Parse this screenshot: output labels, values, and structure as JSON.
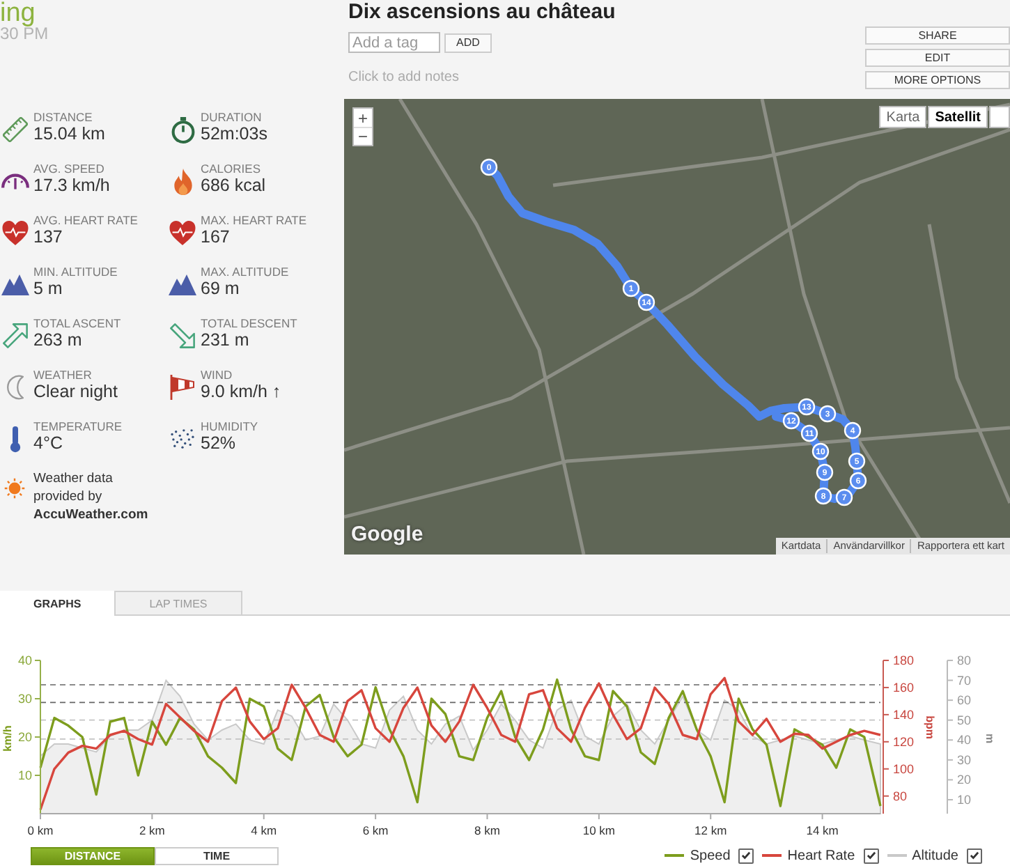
{
  "header": {
    "title": "ing",
    "time": "30 PM"
  },
  "stats": [
    {
      "kind": "distance",
      "label": "DISTANCE",
      "value": "15.04 km"
    },
    {
      "kind": "duration",
      "label": "DURATION",
      "value": "52m:03s"
    },
    {
      "kind": "speed",
      "label": "AVG. SPEED",
      "value": "17.3 km/h"
    },
    {
      "kind": "calories",
      "label": "CALORIES",
      "value": "686 kcal"
    },
    {
      "kind": "heart_rate",
      "label": "AVG. HEART RATE",
      "value": "137"
    },
    {
      "kind": "heart_rate",
      "label": "MAX. HEART RATE",
      "value": "167"
    },
    {
      "kind": "altitude",
      "label": "MIN. ALTITUDE",
      "value": "5 m"
    },
    {
      "kind": "altitude",
      "label": "MAX. ALTITUDE",
      "value": "69 m"
    },
    {
      "kind": "ascent",
      "label": "TOTAL ASCENT",
      "value": "263 m"
    },
    {
      "kind": "descent",
      "label": "TOTAL DESCENT",
      "value": "231 m"
    },
    {
      "kind": "weather",
      "label": "WEATHER",
      "value": "Clear night"
    },
    {
      "kind": "wind",
      "label": "WIND",
      "value": "9.0 km/h ↑"
    },
    {
      "kind": "temperature",
      "label": "TEMPERATURE",
      "value": "4°C"
    },
    {
      "kind": "humidity",
      "label": "HUMIDITY",
      "value": "52%"
    }
  ],
  "weather_credit": "Weather data provided by **AccuWeather.com**",
  "workout": {
    "title": "Dix ascensions au château",
    "tag_input": {
      "placeholder": "Add a tag"
    },
    "add_button": "ADD",
    "notes_prompt": "Click to add notes"
  },
  "actions": [
    "SHARE",
    "EDIT",
    "MORE OPTIONS"
  ],
  "map": {
    "zoom_controls": [
      "+",
      "−"
    ],
    "map_types": [
      {
        "label": "Karta",
        "selected": false
      },
      {
        "label": "Satellit",
        "selected": true
      }
    ],
    "markers": [
      "0",
      "1",
      "14",
      "13",
      "3",
      "12",
      "4",
      "11",
      "10",
      "5",
      "9",
      "6",
      "8",
      "7"
    ],
    "attribution": "Google",
    "footer_links": [
      "Kartdata",
      "Användarvillkor",
      "Rapportera ett kart"
    ]
  },
  "tabs": [
    {
      "label": "GRAPHS",
      "selected": true
    },
    {
      "label": "LAP TIMES",
      "selected": false
    }
  ],
  "graph": {
    "chart_data": {
      "type": "line",
      "x": [
        0,
        0.25,
        0.5,
        0.75,
        1,
        1.25,
        1.5,
        1.75,
        2,
        2.25,
        2.5,
        2.75,
        3,
        3.25,
        3.5,
        3.75,
        4,
        4.25,
        4.5,
        4.75,
        5,
        5.25,
        5.5,
        5.75,
        6,
        6.25,
        6.5,
        6.75,
        7,
        7.25,
        7.5,
        7.75,
        8,
        8.25,
        8.5,
        8.75,
        9,
        9.25,
        9.5,
        9.75,
        10,
        10.25,
        10.5,
        10.75,
        11,
        11.25,
        11.5,
        11.75,
        12,
        12.25,
        12.5,
        12.75,
        13,
        13.25,
        13.5,
        13.75,
        14,
        14.25,
        14.5,
        14.75,
        15.04
      ],
      "xlim": [
        0,
        15.04
      ],
      "xticks": [
        {
          "value": 0,
          "label": "0 km"
        },
        {
          "value": 2,
          "label": "2 km"
        },
        {
          "value": 4,
          "label": "4 km"
        },
        {
          "value": 6,
          "label": "6 km"
        },
        {
          "value": 8,
          "label": "8 km"
        },
        {
          "value": 10,
          "label": "10 km"
        },
        {
          "value": 12,
          "label": "12 km"
        },
        {
          "value": 14,
          "label": "14 km"
        }
      ],
      "ylabel": "km/h",
      "ylim": [
        0,
        40
      ],
      "yticks": [
        10,
        20,
        30,
        40
      ],
      "y2label": "bpm",
      "y2lim": [
        67,
        180
      ],
      "y2ticks": [
        80,
        100,
        120,
        140,
        160,
        180
      ],
      "y3label": "m",
      "y3lim": [
        3,
        80
      ],
      "y3ticks": [
        10,
        20,
        30,
        40,
        50,
        60,
        70,
        80
      ],
      "ref_lines": [
        {
          "axis": "y2",
          "value": 162,
          "color": "#666666"
        },
        {
          "axis": "y2",
          "value": 149,
          "color": "#666666"
        },
        {
          "axis": "y2",
          "value": 136,
          "color": "#c4c4c4"
        },
        {
          "axis": "y2",
          "value": 122,
          "color": "#c4c4c4"
        }
      ],
      "series": [
        {
          "name": "Speed",
          "color": "#7d9d1d",
          "type": "line",
          "axis": "y",
          "values": [
            12,
            25,
            23,
            20,
            5,
            24,
            25,
            10,
            24,
            18,
            25,
            22,
            15,
            12,
            8,
            30,
            28,
            17,
            14,
            28,
            31,
            20,
            15,
            18,
            33,
            22,
            15,
            3,
            30,
            26,
            15,
            14,
            25,
            32,
            20,
            14,
            22,
            35,
            22,
            15,
            14,
            32,
            28,
            16,
            13,
            25,
            32,
            22,
            15,
            3,
            30,
            22,
            18,
            2,
            22,
            20,
            18,
            12,
            22,
            20,
            2
          ]
        },
        {
          "name": "Heart Rate",
          "color": "#d7463d",
          "type": "line",
          "axis": "y2",
          "values": [
            70,
            100,
            112,
            117,
            115,
            125,
            128,
            122,
            118,
            148,
            138,
            128,
            120,
            150,
            160,
            135,
            122,
            130,
            162,
            145,
            125,
            120,
            150,
            158,
            130,
            120,
            145,
            160,
            132,
            120,
            135,
            162,
            145,
            125,
            120,
            155,
            158,
            130,
            120,
            145,
            163,
            140,
            122,
            130,
            160,
            148,
            125,
            122,
            155,
            167,
            135,
            125,
            137,
            120,
            126,
            125,
            115,
            120,
            125,
            128,
            125
          ]
        },
        {
          "name": "Altitude",
          "color": "#c9c9c9",
          "type": "area",
          "axis": "y3",
          "values": [
            32,
            38,
            38,
            36,
            34,
            42,
            45,
            45,
            50,
            70,
            62,
            48,
            40,
            45,
            48,
            40,
            38,
            55,
            52,
            40,
            42,
            58,
            50,
            38,
            36,
            55,
            62,
            45,
            38,
            48,
            52,
            35,
            45,
            58,
            50,
            40,
            36,
            55,
            60,
            42,
            38,
            52,
            58,
            45,
            38,
            50,
            62,
            45,
            40,
            60,
            55,
            42,
            38,
            40,
            42,
            40,
            38,
            40,
            42,
            40,
            38
          ]
        }
      ]
    },
    "x_modes": [
      {
        "label": "DISTANCE",
        "selected": true
      },
      {
        "label": "TIME",
        "selected": false
      }
    ],
    "legend": [
      {
        "checked": true
      },
      {
        "checked": true
      },
      {
        "checked": true
      }
    ]
  }
}
